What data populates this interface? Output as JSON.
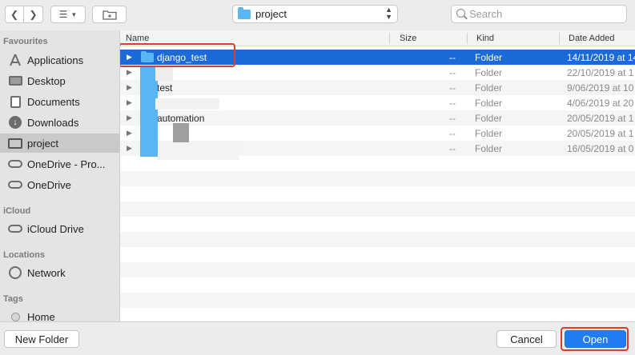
{
  "toolbar": {
    "back_icon": "chevron-left-icon",
    "forward_icon": "chevron-right-icon",
    "view_icon": "list-view-icon",
    "new_folder_icon": "new-folder-icon",
    "location": "project",
    "search_placeholder": "Search"
  },
  "sidebar": {
    "favourites_label": "Favourites",
    "favourites": [
      {
        "label": "Applications",
        "icon": "applications-icon"
      },
      {
        "label": "Desktop",
        "icon": "desktop-icon"
      },
      {
        "label": "Documents",
        "icon": "documents-icon"
      },
      {
        "label": "Downloads",
        "icon": "downloads-icon"
      },
      {
        "label": "project",
        "icon": "folder-icon",
        "selected": true
      },
      {
        "label": "OneDrive - Pro...",
        "icon": "cloud-icon"
      },
      {
        "label": "OneDrive",
        "icon": "cloud-icon"
      }
    ],
    "icloud_label": "iCloud",
    "icloud": [
      {
        "label": "iCloud Drive",
        "icon": "cloud-icon"
      }
    ],
    "locations_label": "Locations",
    "locations": [
      {
        "label": "Network",
        "icon": "network-icon"
      }
    ],
    "tags_label": "Tags",
    "tags": [
      {
        "label": "Home",
        "icon": "tag-icon"
      }
    ]
  },
  "columns": {
    "name": "Name",
    "size": "Size",
    "kind": "Kind",
    "date": "Date Added"
  },
  "rows": [
    {
      "name": "django_test",
      "size": "--",
      "kind": "Folder",
      "date": "14/11/2019 at 14",
      "selected": true
    },
    {
      "name": "",
      "size": "--",
      "kind": "Folder",
      "date": "22/10/2019 at 1"
    },
    {
      "name": "test",
      "size": "--",
      "kind": "Folder",
      "date": "9/06/2019 at 10"
    },
    {
      "name": "",
      "size": "--",
      "kind": "Folder",
      "date": "4/06/2019 at 20"
    },
    {
      "name": "automation",
      "size": "--",
      "kind": "Folder",
      "date": "20/05/2019 at 1"
    },
    {
      "name": "",
      "size": "--",
      "kind": "Folder",
      "date": "20/05/2019 at 1"
    },
    {
      "name": "",
      "size": "--",
      "kind": "Folder",
      "date": "16/05/2019 at 0"
    }
  ],
  "buttons": {
    "new_folder": "New Folder",
    "cancel": "Cancel",
    "open": "Open"
  },
  "colors": {
    "selection": "#1b6ad6",
    "open_button": "#1f7cf2",
    "highlight": "#e03a2b",
    "folder": "#5ab6f3"
  }
}
